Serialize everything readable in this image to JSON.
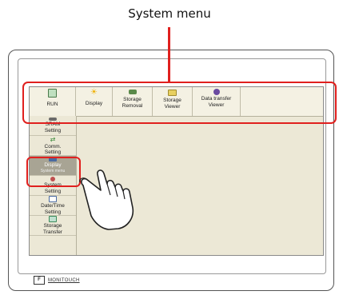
{
  "callout": {
    "title": "System menu"
  },
  "colors": {
    "highlight": "#e0201e",
    "panel": "#ece8d6",
    "selected": "#a8a494"
  },
  "top_menu": [
    {
      "label": "RUN",
      "icon": "run-icon"
    },
    {
      "label": "Display",
      "icon": "sun-icon"
    },
    {
      "label": "Storage\nRemoval",
      "icon": "storage-removal-icon"
    },
    {
      "label": "Storage\nViewer",
      "icon": "folder-icon"
    },
    {
      "label": "Data transfer\nViewer",
      "icon": "globe-icon"
    }
  ],
  "side_menu": [
    {
      "label": "SRAM\nSetting",
      "icon": "sram-icon"
    },
    {
      "label": "Comm.\nSetting",
      "icon": "comm-icon"
    },
    {
      "label": "Display",
      "sublabel": "System menu",
      "icon": "display-icon",
      "selected": true
    },
    {
      "label": "System\nSetting",
      "icon": "system-setting-icon"
    },
    {
      "label": "Date/Time\nSetting",
      "icon": "calendar-icon"
    },
    {
      "label": "Storage\nTransfer",
      "icon": "storage-transfer-icon"
    }
  ],
  "brand": {
    "logo": "F",
    "name": "MONITOUCH"
  }
}
